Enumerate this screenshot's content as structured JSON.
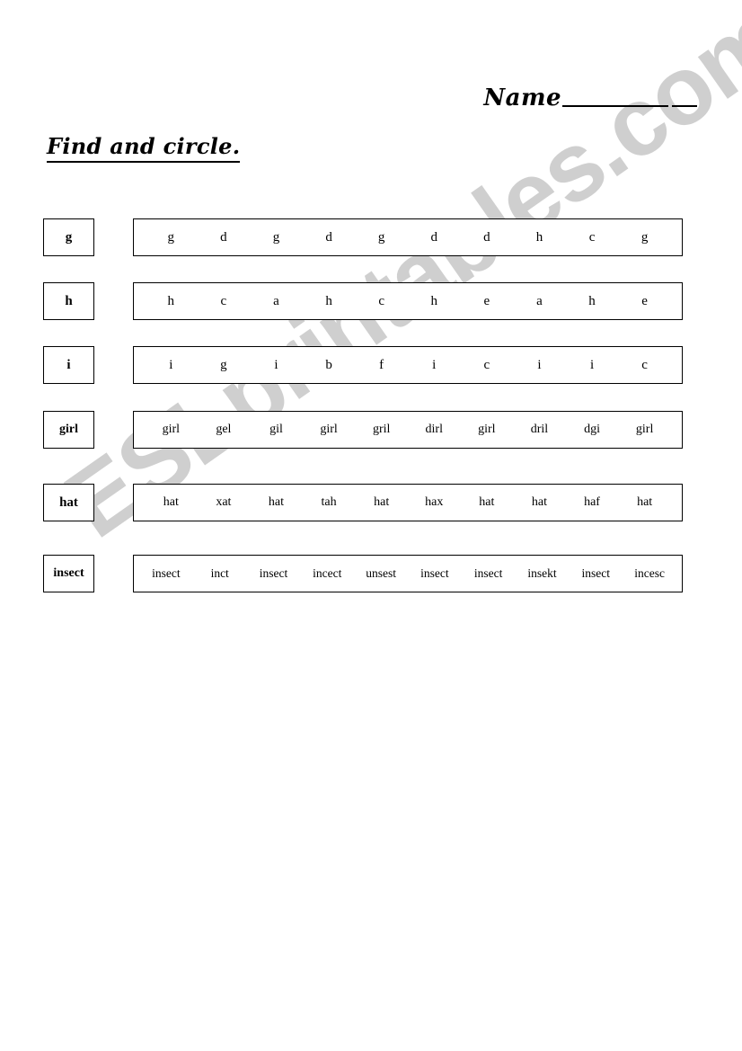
{
  "header": {
    "name_label": "Name",
    "name_rule": "__________",
    "name_rule_short": "___"
  },
  "title": "Find and circle.",
  "watermark": "ESLprintables.com",
  "colors": {
    "ink": "#000000",
    "watermark": "#cfcfcf",
    "page": "#ffffff"
  },
  "rows": [
    {
      "prompt": "g",
      "items": [
        "g",
        "d",
        "g",
        "d",
        "g",
        "d",
        "d",
        "h",
        "c",
        "g"
      ]
    },
    {
      "prompt": "h",
      "items": [
        "h",
        "c",
        "a",
        "h",
        "c",
        "h",
        "e",
        "a",
        "h",
        "e"
      ]
    },
    {
      "prompt": "i",
      "items": [
        "i",
        "g",
        "i",
        "b",
        "f",
        "i",
        "c",
        "i",
        "i",
        "c"
      ]
    },
    {
      "prompt": "girl",
      "items": [
        "girl",
        "gel",
        "gil",
        "girl",
        "gril",
        "dirl",
        "girl",
        "dril",
        "dgi",
        "girl"
      ]
    },
    {
      "prompt": "hat",
      "items": [
        "hat",
        "xat",
        "hat",
        "tah",
        "hat",
        "hax",
        "hat",
        "hat",
        "haf",
        "hat"
      ]
    },
    {
      "prompt": "insect",
      "items": [
        "insect",
        "inct",
        "insect",
        "incect",
        "unsest",
        "insect",
        "insect",
        "insekt",
        "insect",
        "incesc"
      ]
    }
  ]
}
